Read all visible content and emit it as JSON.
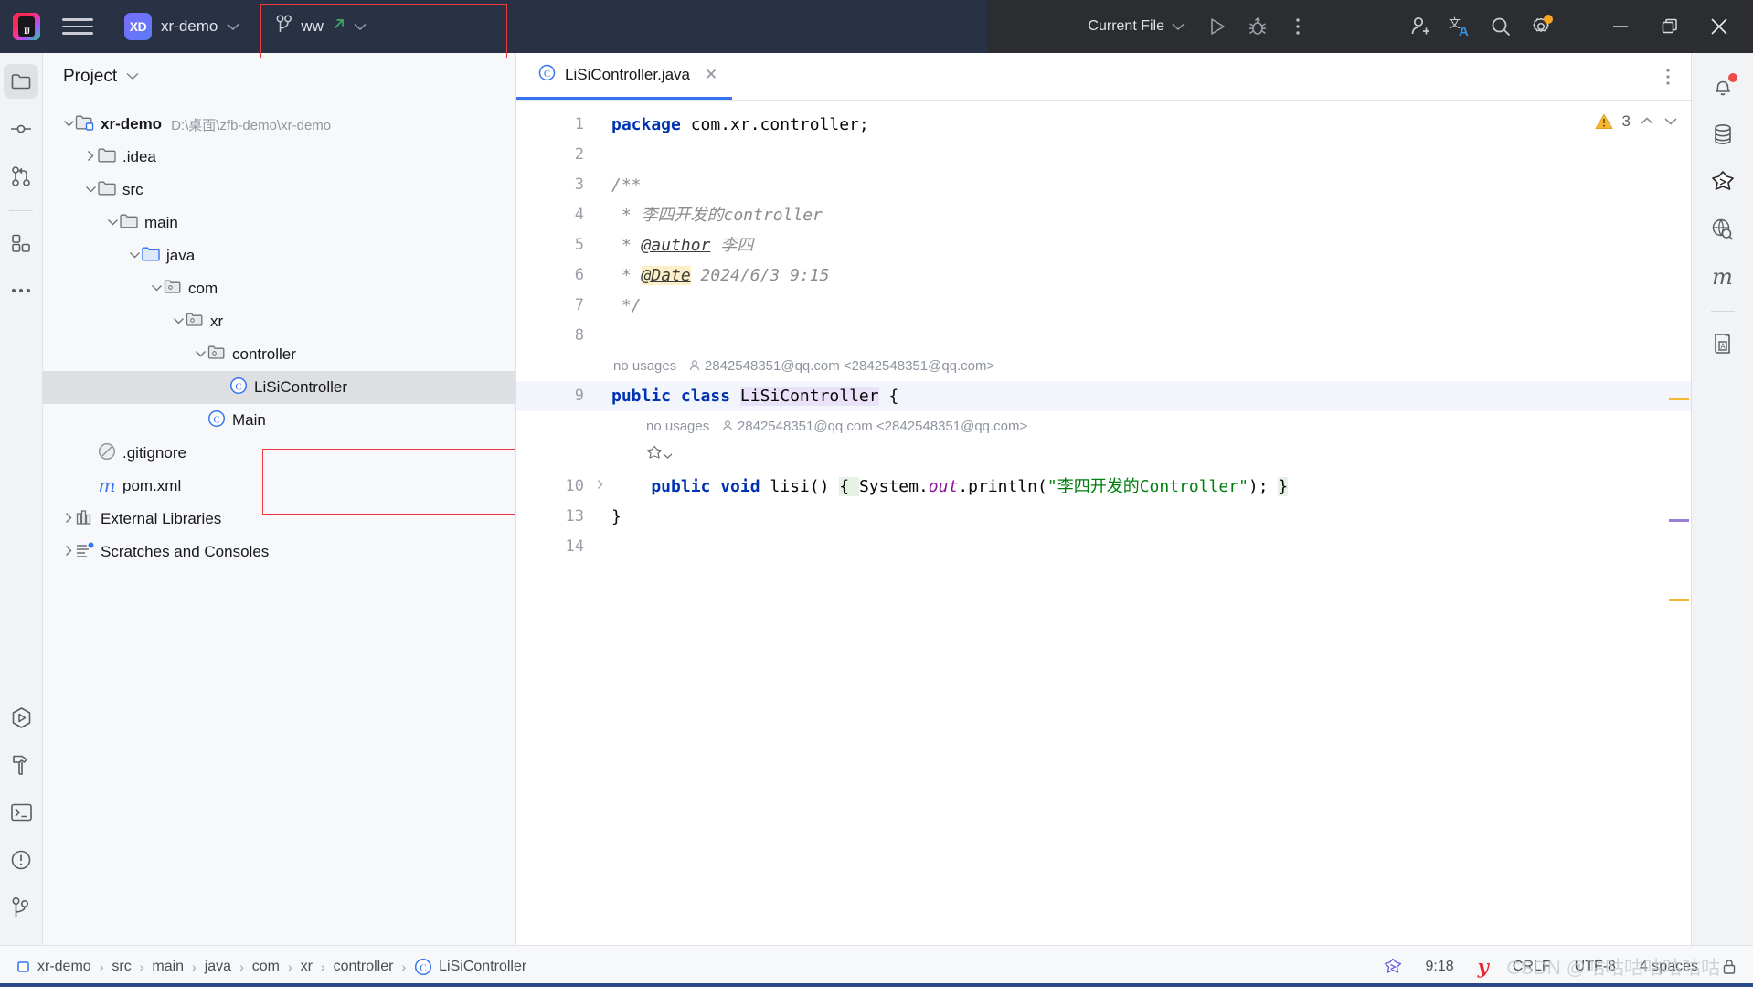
{
  "titlebar": {
    "ide_icon": "intellij-idea-icon",
    "ide_initials": "IJ",
    "menu_icon": "hamburger-menu-icon",
    "project_badge": "XD",
    "project_name": "xr-demo",
    "project_chevron": "chevron-down-icon",
    "branch_icon": "vcs-branch-icon",
    "branch_name": "ww",
    "branch_push_icon": "arrow-up-right-icon",
    "branch_chevron": "chevron-down-icon",
    "run_config": "Current File",
    "run_config_chevron": "chevron-down-icon",
    "run_icon": "run-play-icon",
    "debug_icon": "debug-bug-icon",
    "more_icon": "more-vertical-icon",
    "account_icon": "add-account-icon",
    "translate_icon": "translate-icon",
    "search_icon": "search-icon",
    "settings_icon": "gear-icon",
    "settings_badge": true,
    "minimize_icon": "minimize-icon",
    "maximize_icon": "restore-window-icon",
    "close_icon": "close-icon"
  },
  "left_strip": {
    "items": [
      {
        "name": "project",
        "icon": "folder-icon",
        "active": true
      },
      {
        "name": "commit",
        "icon": "commit-icon",
        "active": false
      },
      {
        "name": "pull-requests",
        "icon": "pull-request-icon",
        "active": false
      },
      {
        "name": "structure",
        "icon": "structure-blocks-icon",
        "active": false
      },
      {
        "name": "more-tool-windows",
        "icon": "more-horizontal-icon",
        "active": false
      }
    ],
    "bottom_items": [
      {
        "name": "run",
        "icon": "run-hexagon-icon"
      },
      {
        "name": "build",
        "icon": "hammer-icon"
      },
      {
        "name": "terminal",
        "icon": "terminal-icon"
      },
      {
        "name": "problems",
        "icon": "warning-circle-icon"
      },
      {
        "name": "version-control",
        "icon": "branch-icon"
      }
    ]
  },
  "project_panel": {
    "title": "Project",
    "title_chevron": "chevron-down-icon",
    "tree": [
      {
        "indent": 0,
        "arrow": "down",
        "icon": "module-icon",
        "label": "xr-demo",
        "bold": true,
        "path": "D:\\桌面\\zfb-demo\\xr-demo",
        "selected": false
      },
      {
        "indent": 1,
        "arrow": "right",
        "icon": "folder-icon",
        "label": ".idea",
        "bold": false,
        "path": "",
        "selected": false
      },
      {
        "indent": 1,
        "arrow": "down",
        "icon": "folder-icon",
        "label": "src",
        "bold": false,
        "path": "",
        "selected": false
      },
      {
        "indent": 2,
        "arrow": "down",
        "icon": "folder-icon",
        "label": "main",
        "bold": false,
        "path": "",
        "selected": false
      },
      {
        "indent": 3,
        "arrow": "down",
        "icon": "source-root-icon",
        "label": "java",
        "bold": false,
        "path": "",
        "selected": false
      },
      {
        "indent": 4,
        "arrow": "down",
        "icon": "package-icon",
        "label": "com",
        "bold": false,
        "path": "",
        "selected": false
      },
      {
        "indent": 5,
        "arrow": "down",
        "icon": "package-icon",
        "label": "xr",
        "bold": false,
        "path": "",
        "selected": false
      },
      {
        "indent": 6,
        "arrow": "down",
        "icon": "package-icon",
        "label": "controller",
        "bold": false,
        "path": "",
        "selected": false
      },
      {
        "indent": 7,
        "arrow": "none",
        "icon": "java-class-icon",
        "label": "LiSiController",
        "bold": false,
        "path": "",
        "selected": true
      },
      {
        "indent": 6,
        "arrow": "none",
        "icon": "java-class-icon",
        "label": "Main",
        "bold": false,
        "path": "",
        "selected": false
      },
      {
        "indent": 1,
        "arrow": "none",
        "icon": "gitignore-icon",
        "label": ".gitignore",
        "bold": false,
        "path": "",
        "selected": false
      },
      {
        "indent": 1,
        "arrow": "none",
        "icon": "maven-icon",
        "label": "pom.xml",
        "bold": false,
        "path": "",
        "selected": false
      },
      {
        "indent": 0,
        "arrow": "right",
        "icon": "library-icon",
        "label": "External Libraries",
        "bold": false,
        "path": "",
        "selected": false
      },
      {
        "indent": 0,
        "arrow": "right",
        "icon": "scratches-icon",
        "label": "Scratches and Consoles",
        "bold": false,
        "path": "",
        "selected": false
      }
    ]
  },
  "editor": {
    "tab": {
      "icon": "java-class-icon",
      "label": "LiSiController.java",
      "close_icon": "close-icon"
    },
    "tab_more_icon": "more-vertical-icon",
    "inspection": {
      "icon": "warning-triangle-icon",
      "count": "3",
      "up_icon": "chevron-up-icon",
      "down_icon": "chevron-down-icon"
    },
    "gutter_lines": [
      "1",
      "2",
      "3",
      "4",
      "5",
      "6",
      "7",
      "8",
      "",
      "9",
      "",
      "",
      "10",
      "13",
      "14"
    ],
    "lines": [
      {
        "no": "1",
        "kind": "code",
        "current": false,
        "tokens": [
          {
            "t": "kw",
            "v": "package"
          },
          {
            "t": "p",
            "v": " com.xr.controller;"
          }
        ]
      },
      {
        "no": "2",
        "kind": "code",
        "current": false,
        "tokens": []
      },
      {
        "no": "3",
        "kind": "code",
        "current": false,
        "tokens": [
          {
            "t": "cmt",
            "v": "/**"
          }
        ]
      },
      {
        "no": "4",
        "kind": "code",
        "current": false,
        "tokens": [
          {
            "t": "cmt",
            "v": " * 李四开发的controller"
          }
        ]
      },
      {
        "no": "5",
        "kind": "code",
        "current": false,
        "tokens": [
          {
            "t": "cmt",
            "v": " * "
          },
          {
            "t": "tag",
            "v": "@author"
          },
          {
            "t": "cmt",
            "v": " 李四"
          }
        ]
      },
      {
        "no": "6",
        "kind": "code",
        "current": false,
        "tokens": [
          {
            "t": "cmt",
            "v": " * "
          },
          {
            "t": "taghl",
            "v": "@Date"
          },
          {
            "t": "cmt",
            "v": " 2024/6/3 9:15"
          }
        ]
      },
      {
        "no": "7",
        "kind": "code",
        "current": false,
        "tokens": [
          {
            "t": "cmt",
            "v": " */"
          }
        ]
      },
      {
        "no": "8",
        "kind": "code",
        "current": false,
        "tokens": []
      },
      {
        "no": "",
        "kind": "hint",
        "current": false,
        "indent": 0,
        "usages": "no usages",
        "author_icon": "author-icon",
        "author": "2842548351@qq.com <2842548351@qq.com>"
      },
      {
        "no": "9",
        "kind": "code",
        "current": true,
        "tokens": [
          {
            "t": "kw",
            "v": "public class "
          },
          {
            "t": "cls",
            "v": "LiSiController"
          },
          {
            "t": "p",
            "v": " {"
          }
        ]
      },
      {
        "no": "",
        "kind": "hint",
        "current": false,
        "indent": 1,
        "usages": "no usages",
        "author_icon": "author-icon",
        "author": "2842548351@qq.com <2842548351@qq.com>"
      },
      {
        "no": "",
        "kind": "gutter-icon",
        "current": false,
        "indent": 1,
        "icon": "bean-gutter-icon",
        "chevron": "chevron-down-icon"
      },
      {
        "no": "10",
        "kind": "code",
        "current": false,
        "fold": true,
        "tokens": [
          {
            "t": "kw",
            "v": "    public void "
          },
          {
            "t": "p",
            "v": "lisi() "
          },
          {
            "t": "fold",
            "v": "{ "
          },
          {
            "t": "p",
            "v": "System."
          },
          {
            "t": "fld",
            "v": "out"
          },
          {
            "t": "p",
            "v": ".println("
          },
          {
            "t": "str",
            "v": "\"李四开发的Controller\""
          },
          {
            "t": "p",
            "v": "); "
          },
          {
            "t": "fold",
            "v": "}"
          }
        ]
      },
      {
        "no": "13",
        "kind": "code",
        "current": false,
        "tokens": [
          {
            "t": "p",
            "v": "}"
          }
        ]
      },
      {
        "no": "14",
        "kind": "code",
        "current": false,
        "tokens": []
      }
    ]
  },
  "right_strip": {
    "items": [
      {
        "name": "notifications",
        "icon": "bell-icon",
        "badge": true
      },
      {
        "name": "database",
        "icon": "database-icon",
        "badge": false
      },
      {
        "name": "ai-assistant",
        "icon": "plugin-3d-icon",
        "badge": false
      },
      {
        "name": "endpoints",
        "icon": "globe-search-icon",
        "badge": false
      },
      {
        "name": "maven",
        "icon": "maven-m-icon",
        "badge": false
      },
      {
        "name": "dictionary",
        "icon": "dictionary-book-icon",
        "badge": false
      }
    ]
  },
  "statusbar": {
    "breadcrumbs": [
      {
        "icon": "module-small-icon",
        "label": "xr-demo"
      },
      {
        "icon": "",
        "label": "src"
      },
      {
        "icon": "",
        "label": "main"
      },
      {
        "icon": "",
        "label": "java"
      },
      {
        "icon": "",
        "label": "com"
      },
      {
        "icon": "",
        "label": "xr"
      },
      {
        "icon": "",
        "label": "controller"
      },
      {
        "icon": "java-class-icon",
        "label": "LiSiController"
      }
    ],
    "separator": "›",
    "right": [
      {
        "name": "ai-assistant-status",
        "icon": "plugin-3d-icon",
        "label": ""
      },
      {
        "name": "caret-position",
        "icon": "",
        "label": "9:18"
      },
      {
        "name": "youdao-translate",
        "icon": "youdao-icon",
        "label": ""
      },
      {
        "name": "line-separator",
        "icon": "",
        "label": "CRLF"
      },
      {
        "name": "file-encoding",
        "icon": "",
        "label": "UTF-8"
      },
      {
        "name": "indent",
        "icon": "",
        "label": "4 spaces"
      },
      {
        "name": "read-only-toggle",
        "icon": "lock-icon",
        "label": ""
      }
    ],
    "watermark": "CSDN @咕咕咕咕咕咕咕"
  },
  "colors": {
    "accent": "#3574f0",
    "titlebar_left": "#293145",
    "titlebar_right": "#2b2d30",
    "panel_bg": "#f7f8fa",
    "warning": "#f5a623",
    "keyword": "#0033b3",
    "string": "#007f0e",
    "comment": "#8c8c8c",
    "field": "#871094",
    "redbox": "#f0393c"
  }
}
